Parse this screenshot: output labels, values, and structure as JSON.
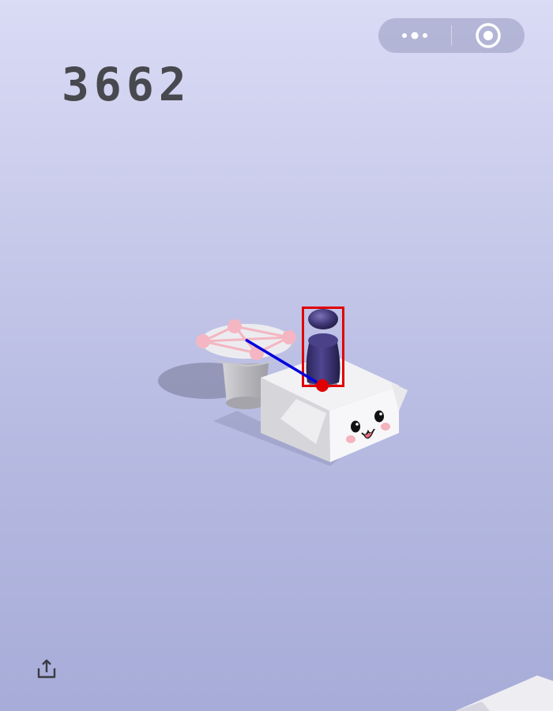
{
  "hud": {
    "score": "3662"
  },
  "capsule": {
    "more_icon": "more-dots-icon",
    "close_icon": "close-target-icon"
  },
  "colors": {
    "score": "#48484f",
    "piece": "#3d3470",
    "bbox": "#e00000",
    "trajectory": "#0000dd",
    "markers": "#f4b6c2"
  },
  "toolbar": {
    "share_icon": "share-icon"
  }
}
